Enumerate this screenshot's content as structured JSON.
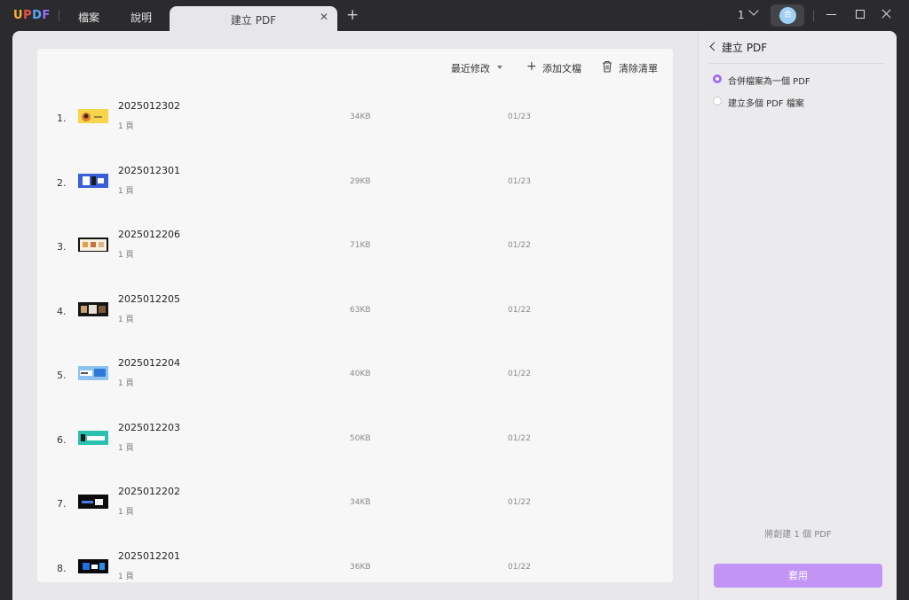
{
  "titlebar": {
    "logo": [
      "U",
      "P",
      "D",
      "F"
    ],
    "menu": [
      "檔案",
      "說明"
    ],
    "tab_label": "建立 PDF",
    "tab_close": "✕",
    "new_tab": "+",
    "page_indicator": "1",
    "avatar_letter": "合"
  },
  "toolbar": {
    "sort_label": "最近修改",
    "add_label": "添加文檔",
    "clear_label": "清除清單"
  },
  "files": [
    {
      "num": "1.",
      "name": "2025012302",
      "pages": "1 頁",
      "size": "34KB",
      "date": "01/23"
    },
    {
      "num": "2.",
      "name": "2025012301",
      "pages": "1 頁",
      "size": "29KB",
      "date": "01/23"
    },
    {
      "num": "3.",
      "name": "2025012206",
      "pages": "1 頁",
      "size": "71KB",
      "date": "01/22"
    },
    {
      "num": "4.",
      "name": "2025012205",
      "pages": "1 頁",
      "size": "63KB",
      "date": "01/22"
    },
    {
      "num": "5.",
      "name": "2025012204",
      "pages": "1 頁",
      "size": "40KB",
      "date": "01/22"
    },
    {
      "num": "6.",
      "name": "2025012203",
      "pages": "1 頁",
      "size": "50KB",
      "date": "01/22"
    },
    {
      "num": "7.",
      "name": "2025012202",
      "pages": "1 頁",
      "size": "34KB",
      "date": "01/22"
    },
    {
      "num": "8.",
      "name": "2025012201",
      "pages": "1 頁",
      "size": "36KB",
      "date": "01/22"
    }
  ],
  "panel": {
    "title": "建立 PDF",
    "options": [
      {
        "label": "合併檔案為一個 PDF",
        "selected": true
      },
      {
        "label": "建立多個 PDF 檔案",
        "selected": false
      }
    ],
    "summary": "將創建 1 個 PDF",
    "apply_label": "套用"
  },
  "colors": {
    "accent": "#a16cf2",
    "apply_button": "#c295f5"
  }
}
